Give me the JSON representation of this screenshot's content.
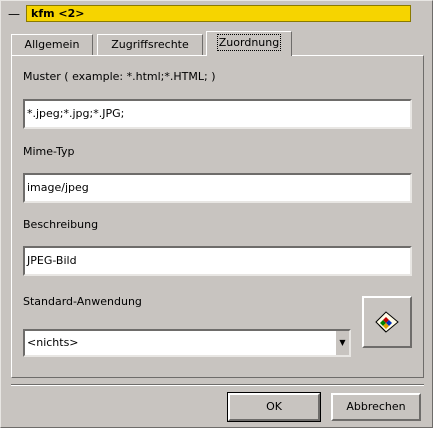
{
  "window": {
    "menu_glyph": "—",
    "title": "kfm <2>",
    "title_color": "#f6d400"
  },
  "tabs": [
    {
      "label": "Allgemein",
      "active": false
    },
    {
      "label": "Zugriffsrechte",
      "active": false
    },
    {
      "label": "Zuordnung",
      "active": true
    }
  ],
  "panel": {
    "pattern_label": "Muster ( example: *.html;*.HTML; )",
    "pattern_value": "*.jpeg;*.jpg;*.JPG;",
    "mime_label": "Mime-Typ",
    "mime_value": "image/jpeg",
    "description_label": "Beschreibung",
    "description_value": "JPEG-Bild",
    "app_label": "Standard-Anwendung",
    "app_value": "<nichts>",
    "app_icon": "image-file-icon"
  },
  "buttons": {
    "ok": "OK",
    "cancel": "Abbrechen"
  }
}
